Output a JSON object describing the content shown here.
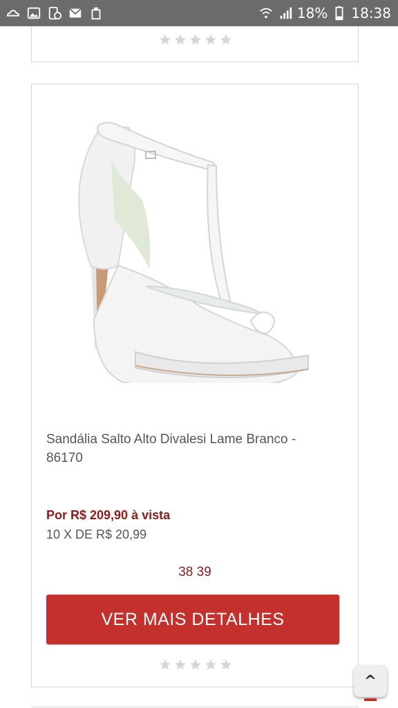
{
  "status_bar": {
    "battery": "18%",
    "time": "18:38",
    "icons": [
      "cloud-icon",
      "image-icon",
      "clock-icon",
      "mail-icon",
      "bag-icon",
      "wifi-icon",
      "signal-icon",
      "battery-icon"
    ]
  },
  "product": {
    "name": "Sandália Salto Alto Divalesi Lame Branco - 86170",
    "price_cash": "Por R$ 209,90 à vista",
    "installments": "10 X DE R$ 20,99",
    "sizes": "38 39",
    "rating_stars": 5,
    "details_button": "VER MAIS DETALHES"
  },
  "scroll_top_button": {
    "label": "^"
  },
  "colors": {
    "accent_red": "#c4302b",
    "price_red": "#8f1a1a",
    "status_bar": "#6b6b6b"
  }
}
